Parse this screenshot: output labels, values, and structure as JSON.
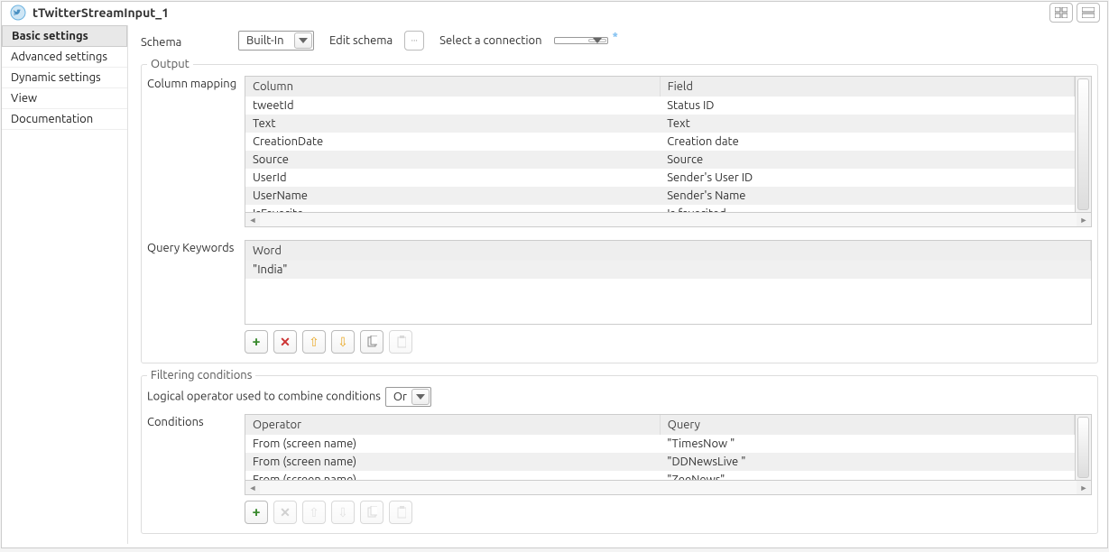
{
  "header": {
    "title": "tTwitterStreamInput_1"
  },
  "sidebar": {
    "items": [
      {
        "label": "Basic settings",
        "active": true
      },
      {
        "label": "Advanced settings",
        "active": false
      },
      {
        "label": "Dynamic settings",
        "active": false
      },
      {
        "label": "View",
        "active": false
      },
      {
        "label": "Documentation",
        "active": false
      }
    ]
  },
  "schema": {
    "label": "Schema",
    "value": "Built-In",
    "editSchemaLabel": "Edit schema",
    "selectConnectionLabel": "Select a connection",
    "connectionValue": ""
  },
  "output": {
    "legend": "Output",
    "columnMappingLabel": "Column mapping",
    "headers": {
      "col": "Column",
      "field": "Field"
    },
    "rows": [
      {
        "col": "tweetId",
        "field": "Status ID"
      },
      {
        "col": "Text",
        "field": "Text"
      },
      {
        "col": "CreationDate",
        "field": "Creation date"
      },
      {
        "col": "Source",
        "field": "Source"
      },
      {
        "col": "UserId",
        "field": "Sender's User ID"
      },
      {
        "col": "UserName",
        "field": "Sender's Name"
      },
      {
        "col": "IsFavorite",
        "field": "Is favorited"
      }
    ]
  },
  "queryKeywords": {
    "label": "Query Keywords",
    "headers": {
      "word": "Word"
    },
    "rows": [
      {
        "word": "\"India\""
      }
    ]
  },
  "filtering": {
    "legend": "Filtering conditions",
    "logicalLabel": "Logical operator used to combine conditions",
    "logicalValue": "Or",
    "conditionsLabel": "Conditions",
    "headers": {
      "op": "Operator",
      "query": "Query"
    },
    "rows": [
      {
        "op": "From (screen name)",
        "query": "\"TimesNow \""
      },
      {
        "op": "From (screen name)",
        "query": "\"DDNewsLive \""
      },
      {
        "op": "From (screen name)",
        "query": "\"ZeeNews\""
      }
    ]
  }
}
